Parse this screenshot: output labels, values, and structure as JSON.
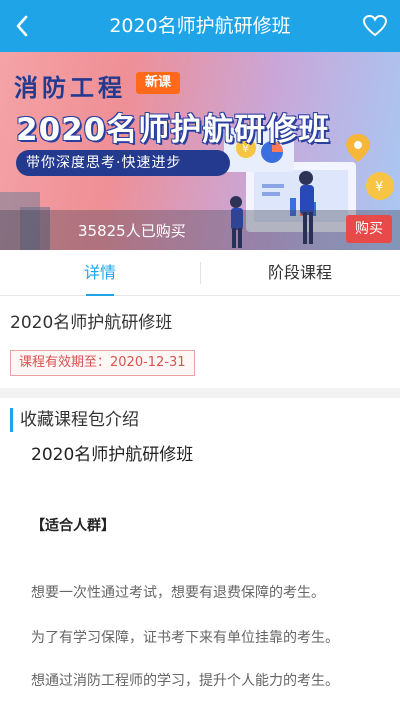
{
  "header": {
    "title": "2020名师护航研修班",
    "back_icon": "chevron-left-icon",
    "favorite_icon": "heart-outline-icon",
    "bg_color": "#20a4e8"
  },
  "banner": {
    "topic": "消防工程",
    "tag": "新课",
    "headline": "2020名师护航研修班",
    "slogan": "带你深度思考·快速进步",
    "buy_count": "35825人已购买",
    "buy_button": "购买"
  },
  "tabs": [
    {
      "label": "详情",
      "active": true
    },
    {
      "label": "阶段课程",
      "active": false
    }
  ],
  "course": {
    "title": "2020名师护航研修班",
    "validity": "课程有效期至：2020-12-31"
  },
  "intro": {
    "section_title": "收藏课程包介绍",
    "course_name": "2020名师护航研修班",
    "audience_heading": "【适合人群】",
    "audience_items": [
      "想要一次性通过考试，想要有退费保障的考生。",
      "为了有学习保障，证书考下来有单位挂靠的考生。",
      "想通过消防工程师的学习，提升个人能力的考生。"
    ]
  },
  "colors": {
    "accent": "#20a4e8",
    "buy_button": "#e84a4a",
    "validity_text": "#d9534f"
  }
}
